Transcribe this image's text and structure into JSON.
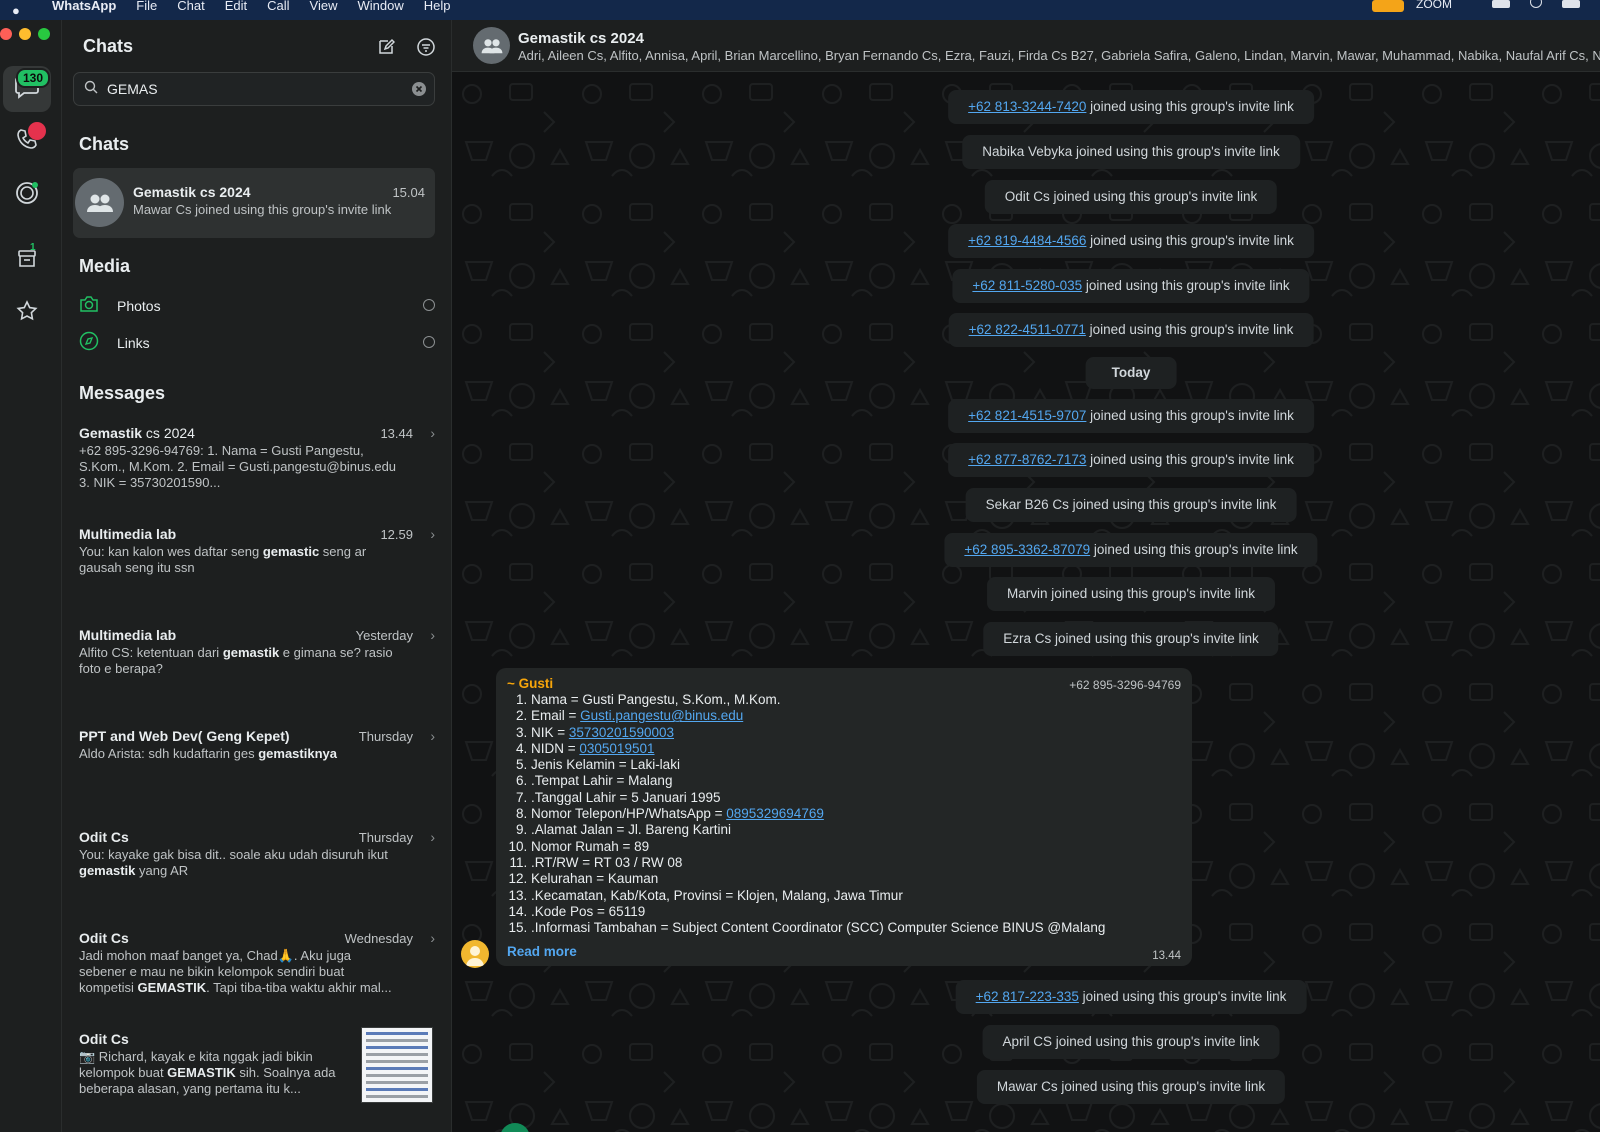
{
  "menubar": {
    "app": "WhatsApp",
    "items": [
      "File",
      "Chat",
      "Edit",
      "Call",
      "View",
      "Window",
      "Help"
    ],
    "zoom_label": "ZOOM"
  },
  "rail": {
    "chats_badge": "130",
    "archived_badge": "1",
    "icons": [
      "chats-icon",
      "calls-icon",
      "status-icon",
      "archive-icon",
      "starred-icon"
    ]
  },
  "sidebar": {
    "title": "Chats",
    "search": {
      "value": "GEMAS"
    },
    "chats_section": "Chats",
    "chat_result": {
      "name": "Gemastik cs 2024",
      "time": "15.04",
      "preview": "Mawar Cs joined using this group's invite link"
    },
    "media_section": "Media",
    "media": [
      {
        "label": "Photos",
        "icon": "camera-icon"
      },
      {
        "label": "Links",
        "icon": "compass-icon"
      }
    ],
    "messages_section": "Messages",
    "messages": [
      {
        "name_bold": "Gemastik",
        "name_rest": " cs 2024",
        "time": "13.44",
        "text": "+62 895-3296-94769: 1. Nama = Gusti Pangestu, S.Kom., M.Kom.   2. Email = Gusti.pangestu@binus.edu   3. NIK = 35730201590..."
      },
      {
        "name_bold": "Multimedia lab",
        "name_rest": "",
        "time": "12.59",
        "pre": "You: kan kalon wes daftar seng ",
        "hit": "gemastic",
        "post": " seng ar gausah seng itu ssn"
      },
      {
        "name_bold": "Multimedia lab",
        "name_rest": "",
        "time": "Yesterday",
        "pre": "Alfito CS: ketentuan dari ",
        "hit": "gemastik",
        "post": " e gimana se? rasio foto e berapa?"
      },
      {
        "name_bold": "PPT and Web Dev( Geng Kepet)",
        "name_rest": "",
        "time": "Thursday",
        "pre": "Aldo Arista: sdh kudaftarin ges ",
        "hit": "gemastiknya",
        "post": ""
      },
      {
        "name_bold": "Odit Cs",
        "name_rest": "",
        "time": "Thursday",
        "pre": "You: kayake gak bisa dit.. soale aku udah disuruh ikut ",
        "hit": "gemastik",
        "post": " yang AR"
      },
      {
        "name_bold": "Odit Cs",
        "name_rest": "",
        "time": "Wednesday",
        "pre": "Jadi mohon maaf banget ya, Chad🙏. Aku juga sebener e mau ne bikin kelompok sendiri buat kompetisi ",
        "hit": "GEMASTIK",
        "post": ". Tapi tiba-tiba waktu akhir mal..."
      },
      {
        "name_bold": "Odit Cs",
        "name_rest": "",
        "time": "",
        "pre": "📷 Richard, kayak e kita nggak jadi bikin kelompok buat ",
        "hit": "GEMASTIK",
        "post": " sih. Soalnya ada beberapa alasan, yang pertama itu k..."
      }
    ]
  },
  "header": {
    "title": "Gemastik cs 2024",
    "members": "Adri, Aileen Cs, Alfito, Annisa, April, Brian Marcellino, Bryan Fernando Cs, Ezra, Fauzi, Firda Cs B27, Gabriela Safira, Galeno, Lindan, Marvin, Mawar, Muhammad, Nabika, Naufal Arif Cs, Nirel, C"
  },
  "conversation": {
    "system_before": [
      {
        "link": "+62 813-3244-7420",
        "text": " joined using this group's invite link"
      },
      {
        "link": "",
        "text": "Nabika Vebyka joined using this group's invite link"
      },
      {
        "link": "",
        "text": "Odit Cs joined using this group's invite link"
      },
      {
        "link": "+62 819-4484-4566",
        "text": " joined using this group's invite link"
      },
      {
        "link": "+62 811-5280-035",
        "text": " joined using this group's invite link"
      },
      {
        "link": "+62 822-4511-0771",
        "text": " joined using this group's invite link"
      }
    ],
    "date_divider": "Today",
    "system_today": [
      {
        "link": "+62 821-4515-9707",
        "text": " joined using this group's invite link"
      },
      {
        "link": "+62 877-8762-7173",
        "text": " joined using this group's invite link"
      },
      {
        "link": "",
        "text": "Sekar B26 Cs joined using this group's invite link"
      },
      {
        "link": "+62 895-3362-87079",
        "text": " joined using this group's invite link"
      },
      {
        "link": "",
        "text": "Marvin joined using this group's invite link"
      },
      {
        "link": "",
        "text": "Ezra Cs joined using this group's invite link"
      }
    ],
    "bubble": {
      "sender": "~ Gusti",
      "phone": "+62 895-3296-94769",
      "lines": [
        {
          "pre": "Nama = Gusti Pangestu, S.Kom., M.Kom.",
          "link": ""
        },
        {
          "pre": "Email = ",
          "link": "Gusti.pangestu@binus.edu"
        },
        {
          "pre": "NIK = ",
          "link": "35730201590003"
        },
        {
          "pre": "NIDN = ",
          "link": "0305019501"
        },
        {
          "pre": "Jenis Kelamin = Laki-laki",
          "link": ""
        },
        {
          "pre": ".Tempat Lahir = Malang",
          "link": ""
        },
        {
          "pre": ".Tanggal Lahir = 5 Januari 1995",
          "link": ""
        },
        {
          "pre": "Nomor Telepon/HP/WhatsApp = ",
          "link": "0895329694769"
        },
        {
          "pre": ".Alamat Jalan = Jl. Bareng Kartini",
          "link": ""
        },
        {
          "pre": "Nomor Rumah = 89",
          "link": ""
        },
        {
          "pre": ".RT/RW = RT 03 / RW 08",
          "link": ""
        },
        {
          "pre": "Kelurahan = Kauman",
          "link": ""
        },
        {
          "pre": ".Kecamatan, Kab/Kota, Provinsi = Klojen, Malang, Jawa Timur",
          "link": ""
        },
        {
          "pre": ".Kode Pos = 65119",
          "link": ""
        },
        {
          "pre": ".Informasi Tambahan  = Subject Content Coordinator (SCC) Computer Science BINUS @Malang",
          "link": ""
        }
      ],
      "read_more": "Read more",
      "time": "13.44"
    },
    "system_after": [
      {
        "link": "+62 817-223-335",
        "text": " joined using this group's invite link"
      },
      {
        "link": "",
        "text": "April CS joined using this group's invite link"
      },
      {
        "link": "",
        "text": "Mawar Cs joined using this group's invite link"
      }
    ]
  }
}
